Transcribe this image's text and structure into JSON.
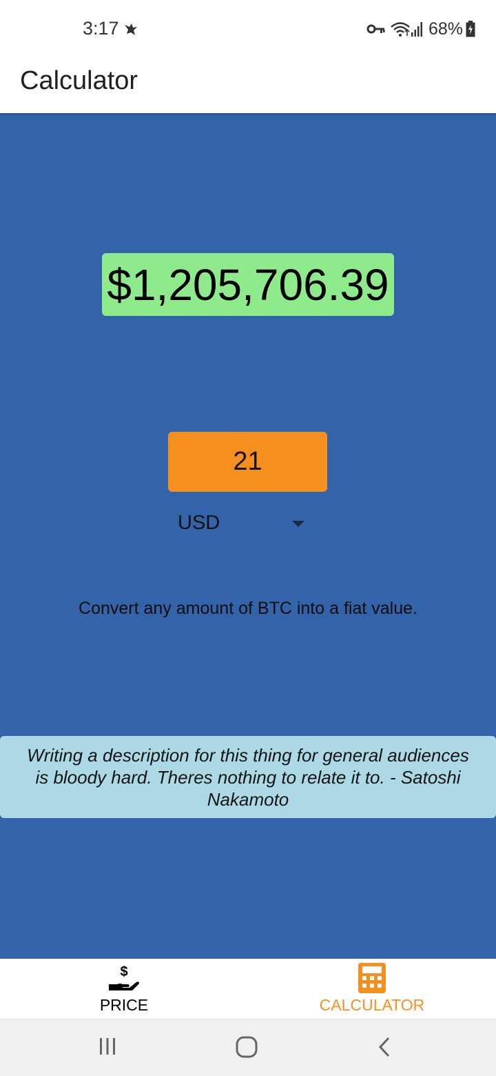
{
  "status_bar": {
    "time": "3:17",
    "battery_percent": "68%",
    "icons": [
      "notification-bird-icon",
      "vpn-key-icon",
      "wifi-icon",
      "signal-icon",
      "battery-charging-icon"
    ]
  },
  "app_bar": {
    "title": "Calculator"
  },
  "calculator": {
    "result": "$1,205,706.39",
    "amount": "21",
    "currency": "USD",
    "description": "Convert any amount of BTC into a fiat value.",
    "quote": "Writing a description for this thing for general audiences is bloody hard. Theres nothing to relate it to. - Satoshi Nakamoto"
  },
  "bottom_nav": {
    "items": [
      {
        "label": "PRICE",
        "icon": "hand-dollar-icon",
        "active": false
      },
      {
        "label": "CALCULATOR",
        "icon": "calculator-icon",
        "active": true
      }
    ],
    "active_color": "#f5901e",
    "inactive_color": "#000000"
  },
  "system_nav": {
    "buttons": [
      "recents",
      "home",
      "back"
    ]
  },
  "colors": {
    "background": "#3363a9",
    "result_bg": "#8eea8a",
    "amount_bg": "#f5901e",
    "quote_bg": "#add8e6"
  }
}
